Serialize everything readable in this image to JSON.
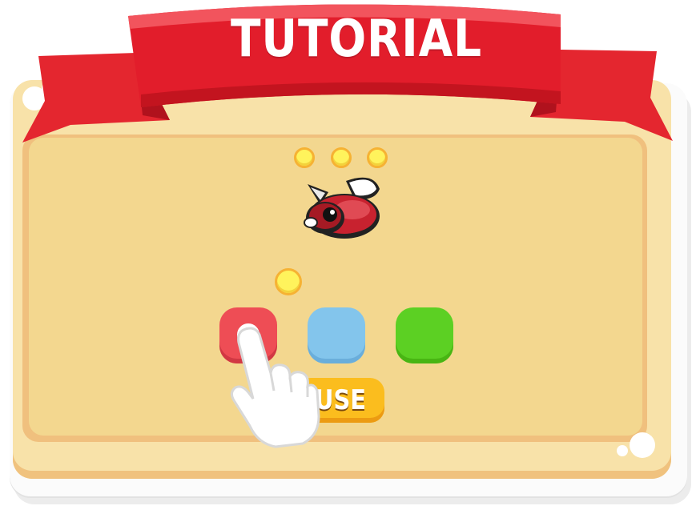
{
  "banner": {
    "title": "TUTORIAL"
  },
  "coins": {
    "top_row_count": 3,
    "single_count": 1
  },
  "color_buttons": [
    {
      "color": "#ee4d55",
      "icon": "target-ring-icon"
    },
    {
      "color": "#83c5ec"
    },
    {
      "color": "#5cd023"
    }
  ],
  "use_button": {
    "label": "USE",
    "color": "#fbbd1e"
  },
  "colors": {
    "ribbon": "#e21d2b",
    "panel": "#f3d78f",
    "coin": "#fff35c"
  },
  "icons": {
    "character": "red-bug-icon",
    "pointer": "pointing-hand-icon",
    "coin": "coin-icon"
  }
}
